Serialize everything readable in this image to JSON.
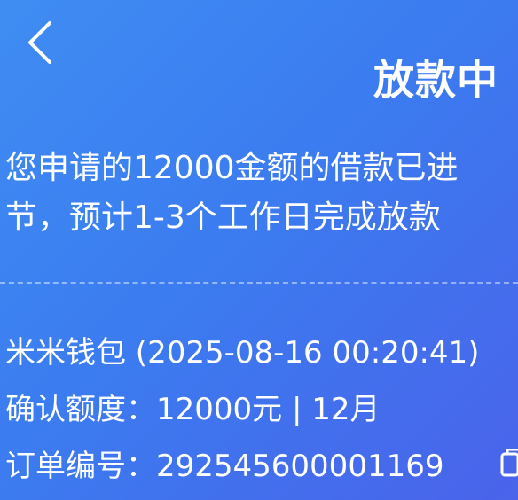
{
  "header": {
    "back_icon": "chevron-left-icon",
    "title": "放款中"
  },
  "message": {
    "line1": "您申请的12000金额的借款已进",
    "line2": "节，预计1-3个工作日完成放款"
  },
  "info": {
    "wallet_line": "米米钱包 (2025-08-16 00:20:41)",
    "amount_line": "确认额度：12000元 | 12月",
    "order_line": "订单编号：292545600001169",
    "copy_icon": "copy-icon"
  },
  "colors": {
    "gradient_start": "#3f8df3",
    "gradient_end": "#4a63ea",
    "text": "#ffffff"
  }
}
